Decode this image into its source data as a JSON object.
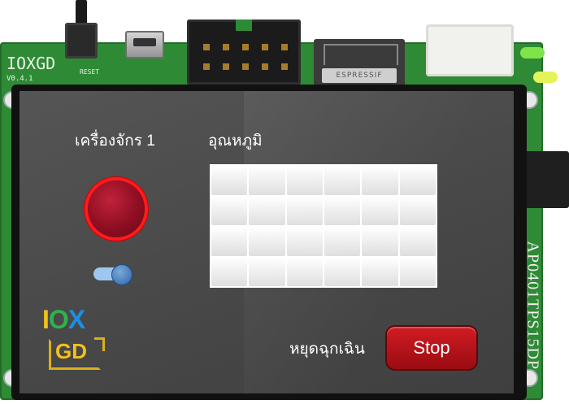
{
  "board": {
    "name": "IOXGD",
    "version": "V0.4.1",
    "reset_label": "RESET",
    "module_label": "ESPRESSIF",
    "display_model": "AP0401TPS15DP"
  },
  "screen": {
    "machine_label": "เครื่องจักร 1",
    "temperature_label": "อุณหภูมิ",
    "emergency_label": "หยุดฉุกเฉิน",
    "stop_button_label": "Stop",
    "toggle_state": "on",
    "grid": {
      "rows": 4,
      "cols": 6
    }
  },
  "logo": {
    "top": "IOX",
    "bottom": "GD"
  },
  "colors": {
    "pcb": "#2f8a35",
    "screen_bg": "#4a4a4a",
    "indicator_red": "#c0223a",
    "stop_button": "#d21b23",
    "logo_i": "#f1c21c",
    "logo_o": "#2fb24a",
    "logo_x": "#1a8fe6",
    "logo_gd": "#f1c21c"
  }
}
